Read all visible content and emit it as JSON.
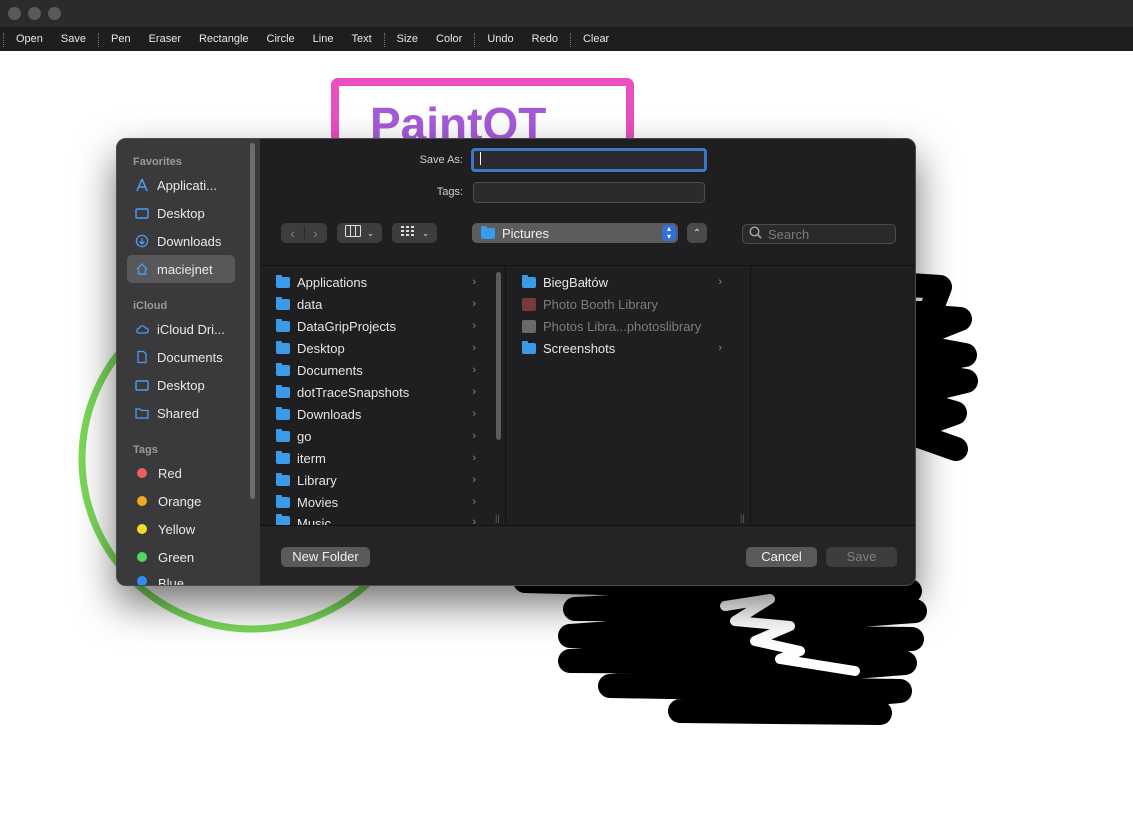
{
  "window": {
    "toolbar": [
      "Open",
      "Save",
      "Pen",
      "Eraser",
      "Rectangle",
      "Circle",
      "Line",
      "Text",
      "Size",
      "Color",
      "Undo",
      "Redo",
      "Clear"
    ]
  },
  "canvas": {
    "title_text": "PaintQT",
    "colors": {
      "rect_stroke": "#e94fbe",
      "title": "#a55bd9",
      "circle": "#7ad85a",
      "scribble": "#000000"
    }
  },
  "dialog": {
    "save_as_label": "Save As:",
    "save_as_value": "",
    "tags_label": "Tags:",
    "location": "Pictures",
    "search_placeholder": "Search",
    "sidebar": {
      "favorites_header": "Favorites",
      "favorites": [
        "Applicati...",
        "Desktop",
        "Downloads",
        "maciejnet"
      ],
      "icloud_header": "iCloud",
      "icloud": [
        "iCloud Dri...",
        "Documents",
        "Desktop",
        "Shared"
      ],
      "tags_header": "Tags",
      "tags": [
        {
          "label": "Red",
          "color": "#ec5f5b"
        },
        {
          "label": "Orange",
          "color": "#f5a623"
        },
        {
          "label": "Yellow",
          "color": "#f2dc2a"
        },
        {
          "label": "Green",
          "color": "#4cd964"
        },
        {
          "label": "Blue",
          "color": "#2e8ef5"
        }
      ]
    },
    "column1": [
      "Applications",
      "data",
      "DataGripProjects",
      "Desktop",
      "Documents",
      "dotTraceSnapshots",
      "Downloads",
      "go",
      "iterm",
      "Library",
      "Movies",
      "Music"
    ],
    "column2": [
      {
        "label": "BiegBałtów",
        "kind": "folder",
        "enabled": true
      },
      {
        "label": "Photo Booth Library",
        "kind": "library",
        "enabled": false
      },
      {
        "label": "Photos Libra...photoslibrary",
        "kind": "library",
        "enabled": false
      },
      {
        "label": "Screenshots",
        "kind": "folder",
        "enabled": true
      }
    ],
    "new_folder": "New Folder",
    "cancel": "Cancel",
    "save": "Save"
  }
}
